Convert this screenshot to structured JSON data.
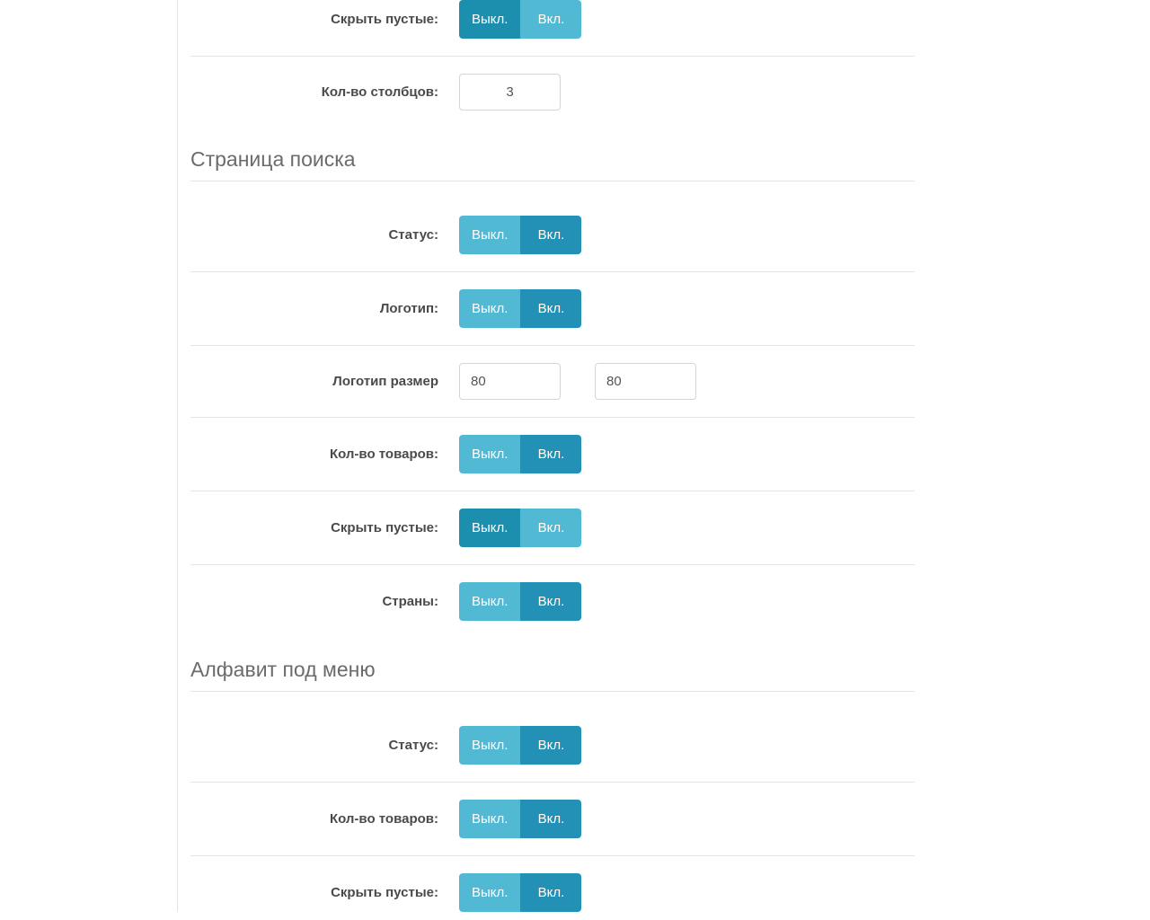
{
  "labels": {
    "off": "Выкл.",
    "on": "Вкл."
  },
  "section0": {
    "hide_empty": {
      "label": "Скрыть пустые:",
      "value": "off"
    },
    "columns": {
      "label": "Кол-во столбцов:",
      "value": "3"
    }
  },
  "section_search": {
    "title": "Страница поиска",
    "status": {
      "label": "Статус:",
      "value": "on"
    },
    "logo": {
      "label": "Логотип:",
      "value": "on"
    },
    "logo_size": {
      "label": "Логотип размер",
      "w": "80",
      "h": "80"
    },
    "product_count": {
      "label": "Кол-во товаров:",
      "value": "on"
    },
    "hide_empty": {
      "label": "Скрыть пустые:",
      "value": "off"
    },
    "countries": {
      "label": "Страны:",
      "value": "on"
    }
  },
  "section_alphabet": {
    "title": "Алфавит под меню",
    "status": {
      "label": "Статус:",
      "value": "on"
    },
    "product_count": {
      "label": "Кол-во товаров:",
      "value": "on"
    },
    "hide_empty": {
      "label": "Скрыть пустые:",
      "value": "on"
    }
  }
}
